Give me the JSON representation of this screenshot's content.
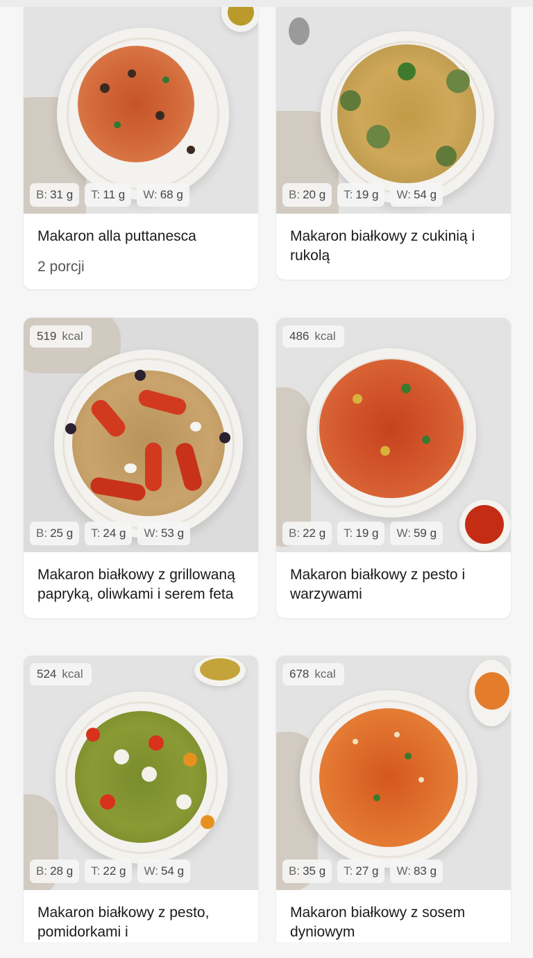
{
  "recipes": [
    {
      "title": "Makaron alla puttanesca",
      "portions": "2 porcji",
      "kcal": "",
      "kcal_unit": "",
      "protein": "31 g",
      "fat": "11 g",
      "carbs": "68 g"
    },
    {
      "title": "Makaron białkowy z cukinią i rukolą",
      "portions": "",
      "kcal": "",
      "kcal_unit": "",
      "protein": "20 g",
      "fat": "19 g",
      "carbs": "54 g"
    },
    {
      "title": "Makaron białkowy z grillowaną papryką, oliwkami i serem feta",
      "portions": "",
      "kcal": "519",
      "kcal_unit": "kcal",
      "protein": "25 g",
      "fat": "24 g",
      "carbs": "53 g"
    },
    {
      "title": "Makaron białkowy z pesto i warzywami",
      "portions": "",
      "kcal": "486",
      "kcal_unit": "kcal",
      "protein": "22 g",
      "fat": "19 g",
      "carbs": "59 g"
    },
    {
      "title": "Makaron białkowy z pesto, pomidorkami i",
      "portions": "",
      "kcal": "524",
      "kcal_unit": "kcal",
      "protein": "28 g",
      "fat": "22 g",
      "carbs": "54 g"
    },
    {
      "title": "Makaron białkowy z sosem dyniowym",
      "portions": "",
      "kcal": "678",
      "kcal_unit": "kcal",
      "protein": "35 g",
      "fat": "27 g",
      "carbs": "83 g"
    }
  ],
  "labels": {
    "protein": "B:",
    "fat": "T:",
    "carbs": "W:"
  }
}
